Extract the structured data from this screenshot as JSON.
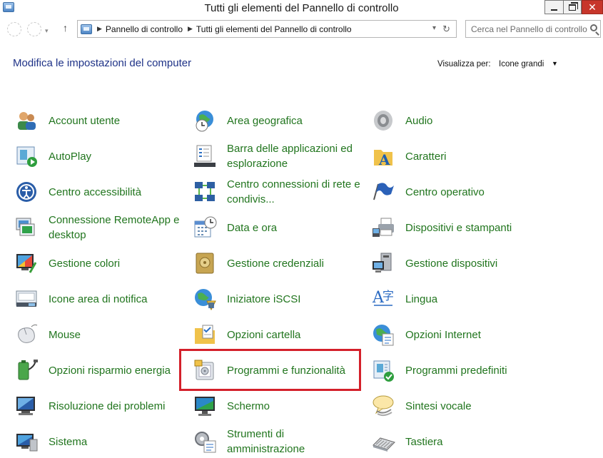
{
  "window": {
    "title": "Tutti gli elementi del Pannello di controllo",
    "minimize_glyph": "—",
    "maximize_glyph": "❐",
    "close_glyph": "✕"
  },
  "navbar": {
    "breadcrumb": [
      "Pannello di controllo",
      "Tutti gli elementi del Pannello di controllo"
    ],
    "search_placeholder": "Cerca nel Pannello di controllo",
    "up_glyph": "↑",
    "dropdown_glyph": "▾",
    "refresh_glyph": "↻",
    "separator_glyph": "▶"
  },
  "header": {
    "heading": "Modifica le impostazioni del computer",
    "view_by_label": "Visualizza per:",
    "view_by_value": "Icone grandi",
    "view_by_arrow": "▼"
  },
  "items": [
    {
      "label": "Account utente",
      "icon": "users-icon",
      "col": 0,
      "row": 0
    },
    {
      "label": "Area geografica",
      "icon": "globe-clock-icon",
      "col": 1,
      "row": 0
    },
    {
      "label": "Audio",
      "icon": "speaker-icon",
      "col": 2,
      "row": 0
    },
    {
      "label": "AutoPlay",
      "icon": "autoplay-icon",
      "col": 0,
      "row": 1
    },
    {
      "label": "Barra delle applicazioni ed esplorazione",
      "icon": "taskbar-icon",
      "col": 1,
      "row": 1
    },
    {
      "label": "Caratteri",
      "icon": "fonts-folder-icon",
      "col": 2,
      "row": 1
    },
    {
      "label": "Centro accessibilità",
      "icon": "accessibility-icon",
      "col": 0,
      "row": 2
    },
    {
      "label": "Centro connessioni di rete e condivis...",
      "icon": "network-icon",
      "col": 1,
      "row": 2
    },
    {
      "label": "Centro operativo",
      "icon": "flag-icon",
      "col": 2,
      "row": 2
    },
    {
      "label": "Connessione RemoteApp e desktop",
      "icon": "remoteapp-icon",
      "col": 0,
      "row": 3
    },
    {
      "label": "Data e ora",
      "icon": "calendar-clock-icon",
      "col": 1,
      "row": 3
    },
    {
      "label": "Dispositivi e stampanti",
      "icon": "printer-icon",
      "col": 2,
      "row": 3
    },
    {
      "label": "Gestione colori",
      "icon": "color-management-icon",
      "col": 0,
      "row": 4
    },
    {
      "label": "Gestione credenziali",
      "icon": "credential-vault-icon",
      "col": 1,
      "row": 4
    },
    {
      "label": "Gestione dispositivi",
      "icon": "device-manager-icon",
      "col": 2,
      "row": 4
    },
    {
      "label": "Icone area di notifica",
      "icon": "notification-area-icon",
      "col": 0,
      "row": 5
    },
    {
      "label": "Iniziatore iSCSI",
      "icon": "iscsi-globe-icon",
      "col": 1,
      "row": 5
    },
    {
      "label": "Lingua",
      "icon": "language-icon",
      "col": 2,
      "row": 5
    },
    {
      "label": "Mouse",
      "icon": "mouse-icon",
      "col": 0,
      "row": 6
    },
    {
      "label": "Opzioni cartella",
      "icon": "folder-options-icon",
      "col": 1,
      "row": 6
    },
    {
      "label": "Opzioni Internet",
      "icon": "internet-options-icon",
      "col": 2,
      "row": 6
    },
    {
      "label": "Opzioni risparmio energia",
      "icon": "power-options-icon",
      "col": 0,
      "row": 7
    },
    {
      "label": "Programmi e funzionalità",
      "icon": "programs-features-icon",
      "col": 1,
      "row": 7
    },
    {
      "label": "Programmi predefiniti",
      "icon": "default-programs-icon",
      "col": 2,
      "row": 7
    },
    {
      "label": "Risoluzione dei problemi",
      "icon": "troubleshooting-icon",
      "col": 0,
      "row": 8
    },
    {
      "label": "Schermo",
      "icon": "display-icon",
      "col": 1,
      "row": 8
    },
    {
      "label": "Sintesi vocale",
      "icon": "speech-icon",
      "col": 2,
      "row": 8
    },
    {
      "label": "Sistema",
      "icon": "system-icon",
      "col": 0,
      "row": 9
    },
    {
      "label": "Strumenti di amministrazione",
      "icon": "admin-tools-icon",
      "col": 1,
      "row": 9
    },
    {
      "label": "Tastiera",
      "icon": "keyboard-icon",
      "col": 2,
      "row": 9
    }
  ],
  "colors": {
    "link_green": "#21751e",
    "heading_blue": "#1e3287",
    "highlight_red": "#d4202a"
  }
}
